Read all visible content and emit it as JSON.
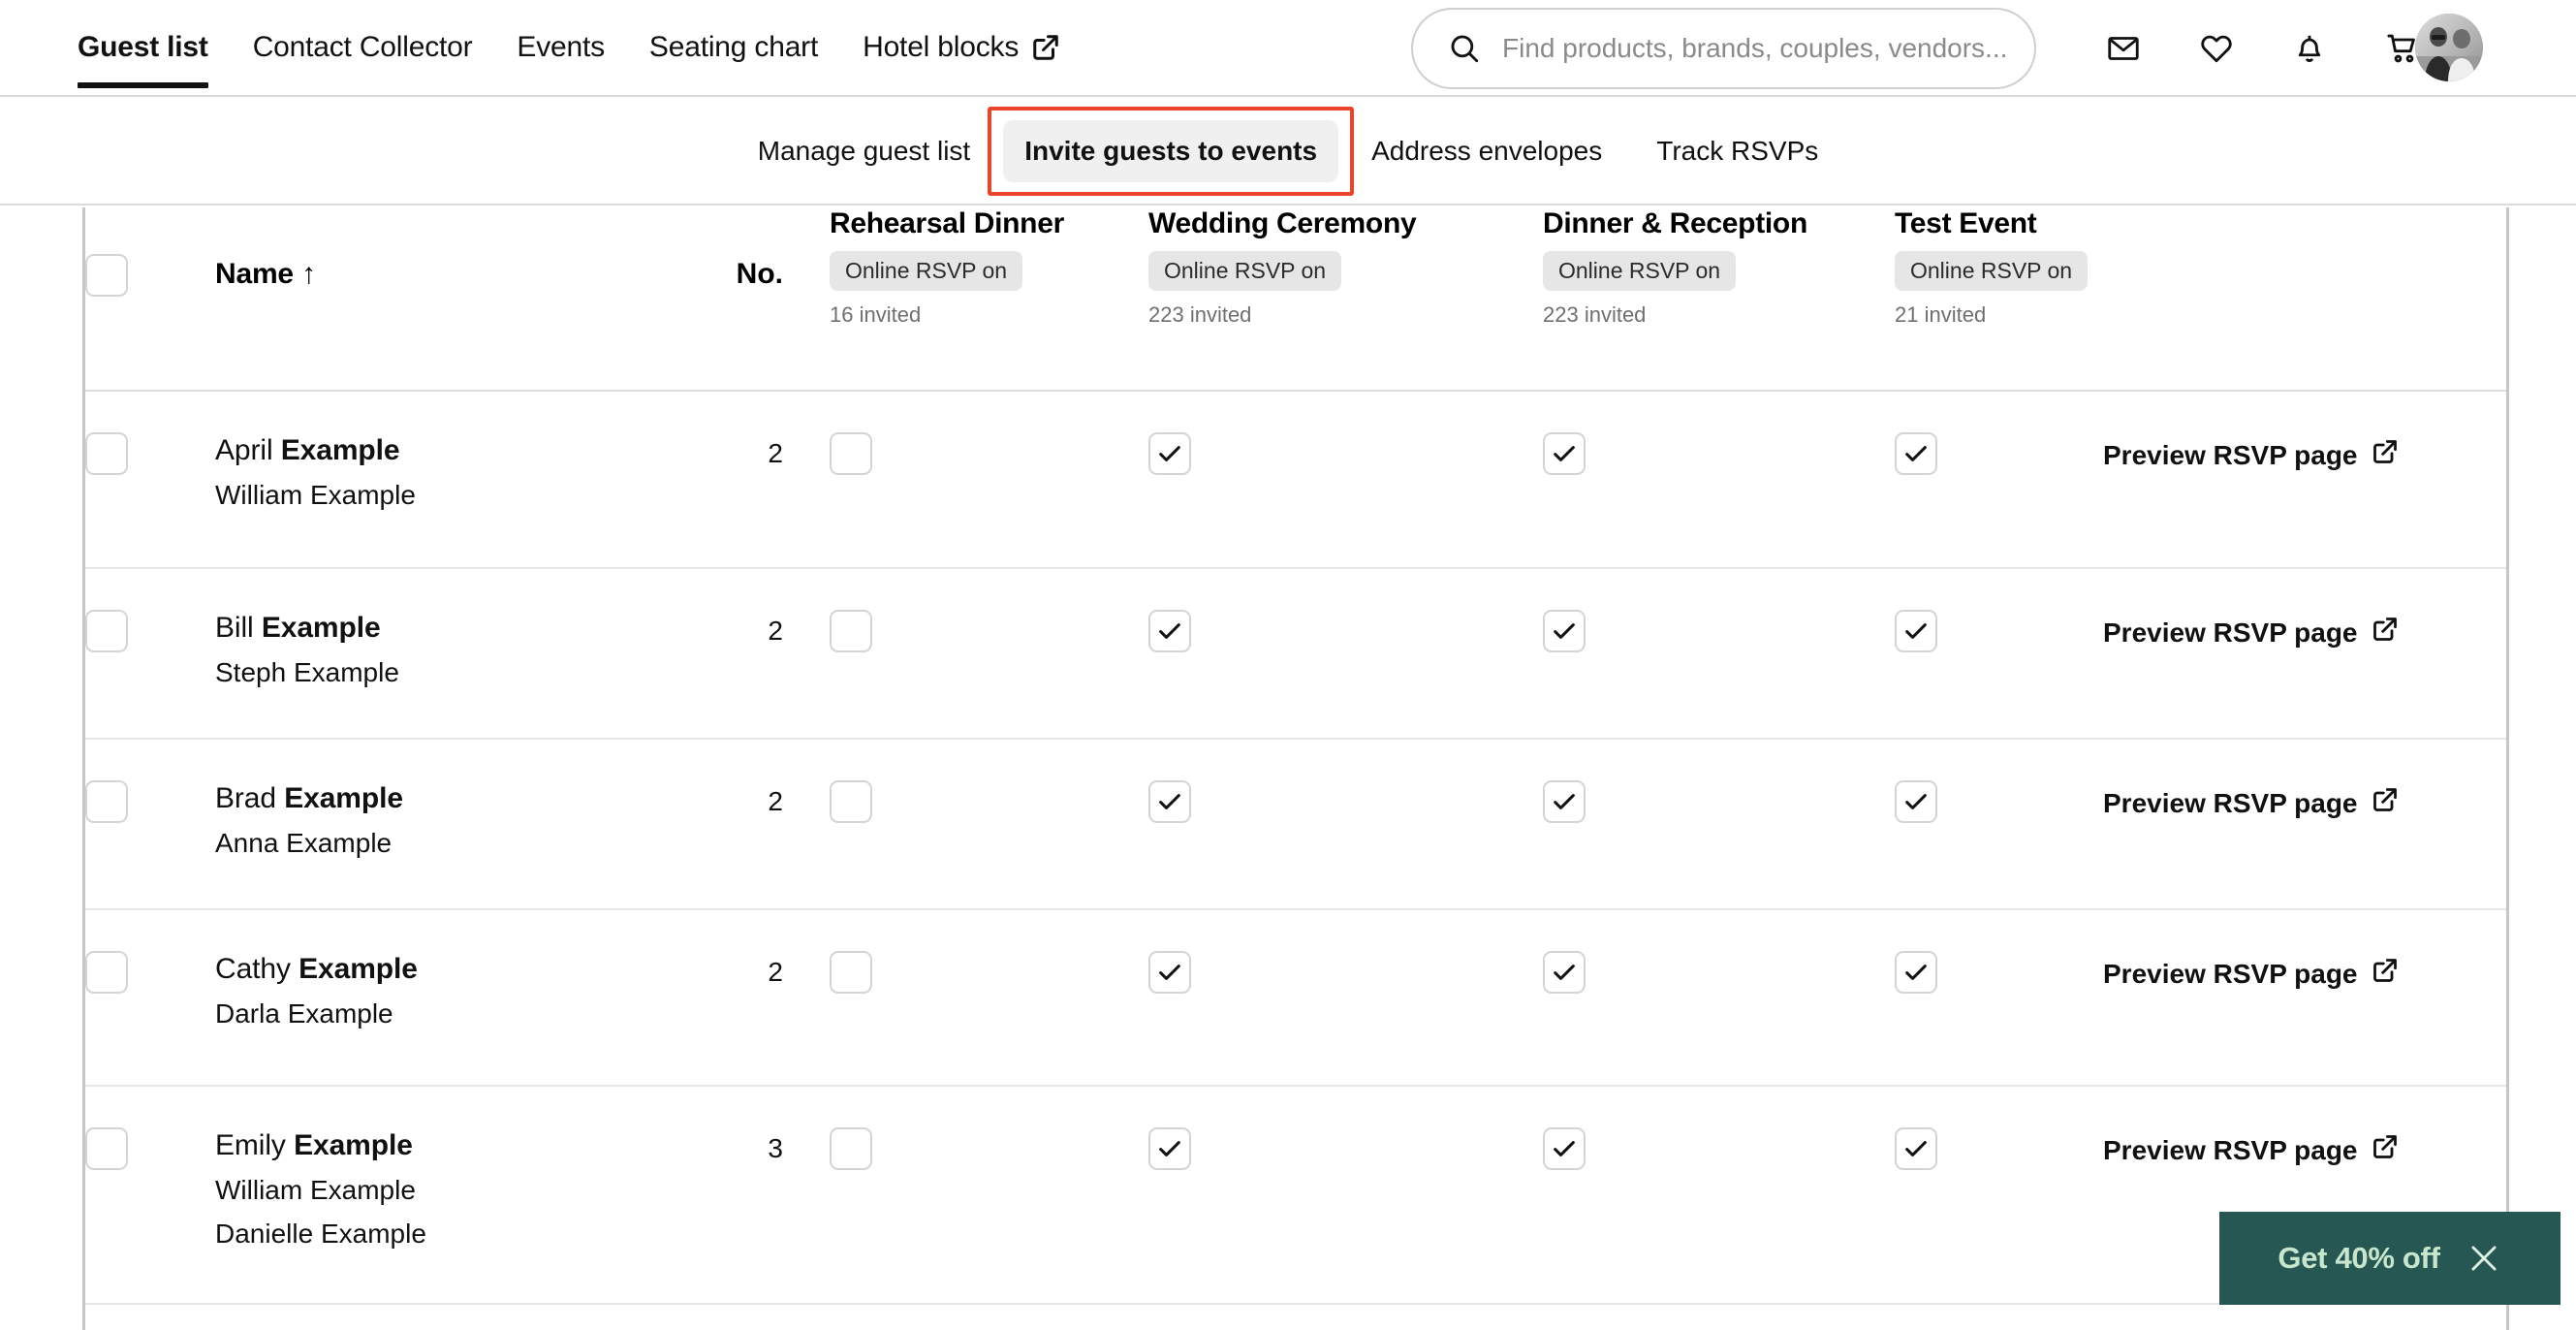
{
  "header": {
    "primary_nav": [
      {
        "label": "Guest list",
        "active": true,
        "external": false
      },
      {
        "label": "Contact Collector",
        "active": false,
        "external": false
      },
      {
        "label": "Events",
        "active": false,
        "external": false
      },
      {
        "label": "Seating chart",
        "active": false,
        "external": false
      },
      {
        "label": "Hotel blocks",
        "active": false,
        "external": true
      }
    ],
    "search": {
      "placeholder": "Find products, brands, couples, vendors...",
      "value": ""
    },
    "icons": [
      "envelope-icon",
      "heart-icon",
      "bell-icon",
      "cart-icon"
    ],
    "avatar": "user-avatar"
  },
  "sub_nav": {
    "items": [
      {
        "label": "Manage guest list",
        "selected": false,
        "annotated": false
      },
      {
        "label": "Invite guests to events",
        "selected": true,
        "annotated": true
      },
      {
        "label": "Address envelopes",
        "selected": false,
        "annotated": false
      },
      {
        "label": "Track RSVPs",
        "selected": false,
        "annotated": false
      }
    ],
    "annotation_color": "#e8452a"
  },
  "table": {
    "columns": {
      "name": "Name",
      "name_sort_glyph": "↑",
      "number": "No."
    },
    "events": [
      {
        "title": "Rehearsal Dinner",
        "status": "Online RSVP on",
        "invited": "16 invited"
      },
      {
        "title": "Wedding Ceremony",
        "status": "Online RSVP on",
        "invited": "223 invited"
      },
      {
        "title": "Dinner & Reception",
        "status": "Online RSVP on",
        "invited": "223 invited"
      },
      {
        "title": "Test Event",
        "status": "Online RSVP on",
        "invited": "21 invited"
      }
    ],
    "action_label": "Preview RSVP page",
    "rows": [
      {
        "first_name": "April ",
        "last_name": "Example",
        "members": [
          "William Example"
        ],
        "count": "2",
        "invites": [
          false,
          true,
          true,
          true
        ],
        "selected": false
      },
      {
        "first_name": "Bill ",
        "last_name": "Example",
        "members": [
          "Steph Example"
        ],
        "count": "2",
        "invites": [
          false,
          true,
          true,
          true
        ],
        "selected": false
      },
      {
        "first_name": "Brad ",
        "last_name": "Example",
        "members": [
          "Anna Example"
        ],
        "count": "2",
        "invites": [
          false,
          true,
          true,
          true
        ],
        "selected": false
      },
      {
        "first_name": "Cathy ",
        "last_name": "Example",
        "members": [
          "Darla Example"
        ],
        "count": "2",
        "invites": [
          false,
          true,
          true,
          true
        ],
        "selected": false
      },
      {
        "first_name": "Emily ",
        "last_name": "Example",
        "members": [
          "William Example",
          "Danielle Example"
        ],
        "count": "3",
        "invites": [
          false,
          true,
          true,
          true
        ],
        "selected": false
      }
    ]
  },
  "promo": {
    "label": "Get 40% off",
    "background": "#265753",
    "text_color": "#c8e6cd"
  }
}
